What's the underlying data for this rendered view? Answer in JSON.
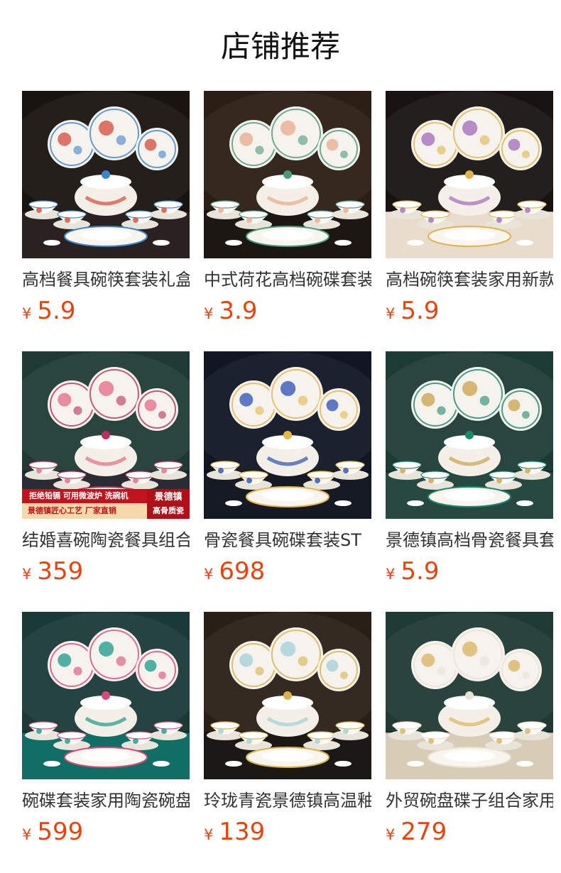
{
  "header": {
    "title": "店铺推荐"
  },
  "products": [
    {
      "title": "高档餐具碗筷套装礼盒",
      "currency": "¥",
      "price": "5.9",
      "image_icon": "floral-dinnerware-set-photo",
      "theme": {
        "bg": "#1a1410",
        "accent": "#d64a3a",
        "accent2": "#3e86c9",
        "table": "#2a2220"
      }
    },
    {
      "title": "中式荷花高档碗碟套装",
      "currency": "¥",
      "price": "3.9",
      "image_icon": "lotus-dinnerware-set-photo",
      "theme": {
        "bg": "#2b1e14",
        "accent": "#e8a98c",
        "accent2": "#4a9a7c",
        "table": "#1c1712"
      }
    },
    {
      "title": "高档碗筷套装家用新款",
      "currency": "¥",
      "price": "5.9",
      "image_icon": "purple-floral-dinnerware-photo",
      "theme": {
        "bg": "#181310",
        "accent": "#a26ab8",
        "accent2": "#e0b44a",
        "table": "#e9dccd"
      }
    },
    {
      "title": "结婚喜碗陶瓷餐具组合",
      "currency": "¥",
      "price": "359",
      "image_icon": "pink-blossom-dinnerware-photo",
      "theme": {
        "bg": "#1f3a34",
        "accent": "#e46a86",
        "accent2": "#b9315a",
        "table": "#2a2c33"
      },
      "promo": {
        "line1": "拒绝铅镉 可用微波炉 洗碗机",
        "line2": "景德镇匠心工艺 厂家直销",
        "r1": "景德镇",
        "r2": "高骨质瓷"
      }
    },
    {
      "title": "骨瓷餐具碗碟套装ST",
      "currency": "¥",
      "price": "698",
      "image_icon": "blue-lattice-dinnerware-photo",
      "theme": {
        "bg": "#0f1624",
        "accent": "#2b4fb4",
        "accent2": "#e8b54a",
        "table": "#151a24"
      }
    },
    {
      "title": "景德镇高档骨瓷餐具套装",
      "currency": "¥",
      "price": "5.9",
      "image_icon": "gold-rim-dinnerware-photo",
      "theme": {
        "bg": "#1d3b35",
        "accent": "#c9a24a",
        "accent2": "#1a8a6a",
        "table": "#264a40"
      }
    },
    {
      "title": "碗碟套装家用陶瓷碗盘",
      "currency": "¥",
      "price": "599",
      "image_icon": "teal-peony-dinnerware-photo",
      "theme": {
        "bg": "#1a3a37",
        "accent": "#1a9a8a",
        "accent2": "#d8497a",
        "table": "#0f6e66"
      }
    },
    {
      "title": "玲珑青瓷景德镇高温釉",
      "currency": "¥",
      "price": "139",
      "image_icon": "celadon-dinnerware-photo",
      "theme": {
        "bg": "#2a1f17",
        "accent": "#9fd0d6",
        "accent2": "#d8b24a",
        "table": "#1c1815"
      }
    },
    {
      "title": "外贸碗盘碟子组合家用",
      "currency": "¥",
      "price": "279",
      "image_icon": "white-gold-dinnerware-photo",
      "theme": {
        "bg": "#1f3a33",
        "accent": "#d9b35c",
        "accent2": "#e9e2d2",
        "table": "#d8ccb6"
      }
    }
  ]
}
